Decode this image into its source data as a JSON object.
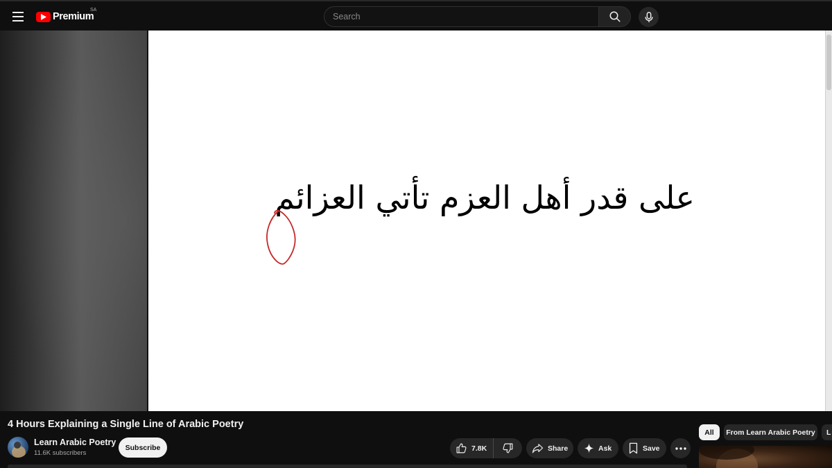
{
  "header": {
    "logo_text": "Premium",
    "country_code": "SA",
    "search_placeholder": "Search"
  },
  "video": {
    "slide_text": "على قدر أهل العزم تأتي العزائم",
    "title": "4 Hours Explaining a Single Line of Arabic Poetry"
  },
  "channel": {
    "name": "Learn Arabic Poetry",
    "subscribers": "11.6K subscribers",
    "subscribe_label": "Subscribe"
  },
  "actions": {
    "like_count": "7.8K",
    "share_label": "Share",
    "ask_label": "Ask",
    "save_label": "Save"
  },
  "chips": [
    "All",
    "From Learn Arabic Poetry",
    "L"
  ],
  "colors": {
    "brand_red": "#ff0000",
    "background": "#0f0f0f",
    "pill": "#272727",
    "annotation_red": "#c62828"
  },
  "icons": [
    "menu-icon",
    "youtube-logo-icon",
    "search-icon",
    "mic-icon",
    "like-icon",
    "dislike-icon",
    "share-icon",
    "ask-sparkle-icon",
    "save-icon",
    "more-icon"
  ]
}
